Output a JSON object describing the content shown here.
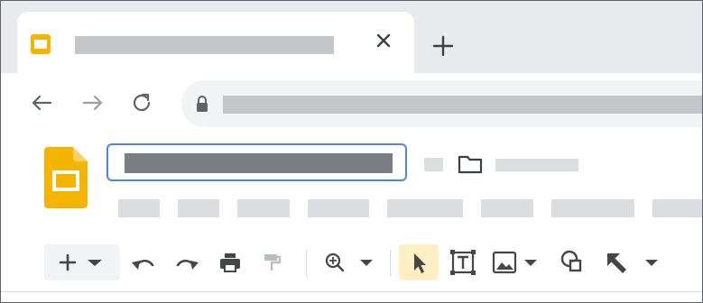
{
  "colors": {
    "tab_strip": "#e8eaed",
    "placeholder": "#c4c6c9",
    "title_focus_border": "#4a86e8",
    "slides_yellow": "#f4b400",
    "active_tool_bg": "#feefc3",
    "icon": "#444746"
  },
  "tab": {
    "favicon": "google-slides-icon",
    "close_icon": "close-icon",
    "new_tab_icon": "plus-icon"
  },
  "navigation": {
    "back_icon": "arrow-left-icon",
    "forward_icon": "arrow-right-icon",
    "reload_icon": "reload-icon",
    "lock_icon": "lock-icon"
  },
  "header": {
    "logo": "google-slides-logo",
    "folder_icon": "folder-icon",
    "menu_count": 9
  },
  "toolbar": {
    "items": [
      "new-slide-icon",
      "undo-icon",
      "redo-icon",
      "print-icon",
      "paint-format-icon",
      "zoom-icon",
      "select-icon",
      "text-box-icon",
      "image-icon",
      "shape-icon",
      "line-icon"
    ],
    "active_tool": "select-icon"
  }
}
